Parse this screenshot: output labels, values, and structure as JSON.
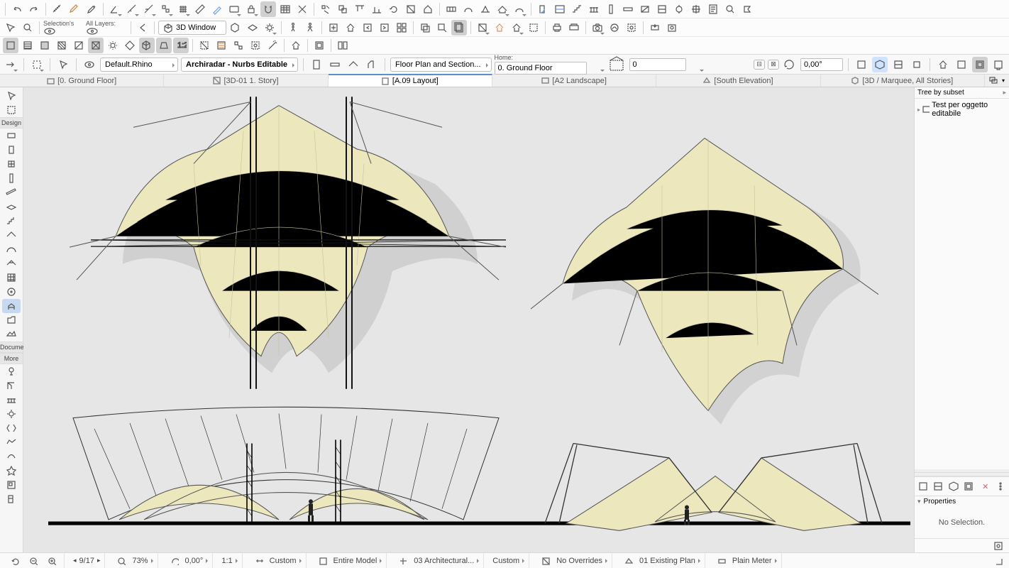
{
  "quickAccess": {
    "selectionLabel": "Selection's",
    "layersLabel": "All Layers:",
    "window3d": "3D Window"
  },
  "ctx": {
    "layerCombo": "Default.Rhino",
    "favCombo": "Archiradar - Nurbs Editable",
    "viewCombo": "Floor Plan and Section...",
    "homeLabel": "Home:",
    "homeStory": "0. Ground Floor",
    "elev": "0",
    "angle": "0,00°"
  },
  "tabs": [
    {
      "icon": "folder",
      "label": "[0. Ground Floor]"
    },
    {
      "icon": "image",
      "label": "[3D-01 1. Story]"
    },
    {
      "icon": "doc",
      "label": "[A.09 Layout]",
      "active": true
    },
    {
      "icon": "layout",
      "label": "[A2 Landscape]"
    },
    {
      "icon": "elev",
      "label": "[South Elevation]"
    },
    {
      "icon": "3d",
      "label": "[3D / Marquee, All Stories]"
    }
  ],
  "toolbox": {
    "sectDesign": "Design",
    "sectDoc": "Docume",
    "sectMore": "More"
  },
  "navigator": {
    "headLabel": "Tree by subset",
    "node": "Test per oggetto editabile",
    "propTitle": "Properties",
    "noSelection": "No Selection."
  },
  "status": {
    "page": "9/17",
    "zoom": "73%",
    "angle": "0,00°",
    "scale": "1:1",
    "dim": "Custom",
    "model": "Entire Model",
    "layerGroup": "03 Architectural...",
    "pen": "Custom",
    "overrides": "No Overrides",
    "reno": "01 Existing Plan",
    "units": "Plain Meter"
  }
}
